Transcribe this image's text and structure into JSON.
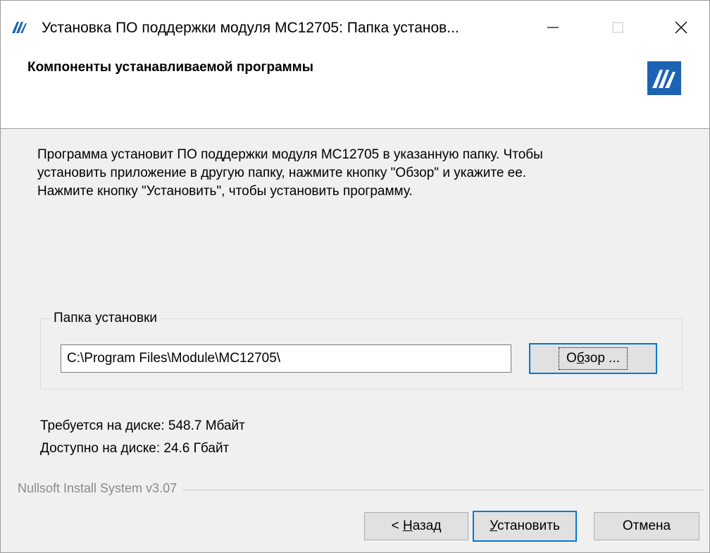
{
  "window": {
    "title": "Установка ПО поддержки модуля МС12705: Папка установ...",
    "icon": "nsis-m-logo-icon",
    "controls": [
      "minimize-icon",
      "maximize-icon",
      "close-icon"
    ]
  },
  "header": {
    "title": "Компоненты устанавливаемой программы",
    "logo": "nsis-m-logo-icon",
    "logo_color": "#1d63b3"
  },
  "description": {
    "line1": "Программа установит ПО поддержки модуля МС12705 в указанную папку. Чтобы",
    "line2": "установить приложение в другую папку, нажмите кнопку \"Обзор\" и укажите ее.",
    "line3": "Нажмите кнопку \"Установить\", чтобы установить программу."
  },
  "install_folder": {
    "group_label": "Папка установки",
    "path_value": "C:\\Program Files\\Module\\MC12705\\",
    "browse_pre": "О",
    "browse_ul": "б",
    "browse_post": "зор ..."
  },
  "disk": {
    "required": "Требуется на диске: 548.7 Мбайт",
    "available": "Доступно на диске: 24.6 Гбайт"
  },
  "branding": "Nullsoft Install System v3.07",
  "buttons": {
    "back_pre": "< ",
    "back_ul": "Н",
    "back_post": "азад",
    "install_ul": "У",
    "install_post": "становить",
    "cancel": "Отмена"
  },
  "colors": {
    "accent": "#0078d7",
    "logo": "#1d63b3"
  }
}
